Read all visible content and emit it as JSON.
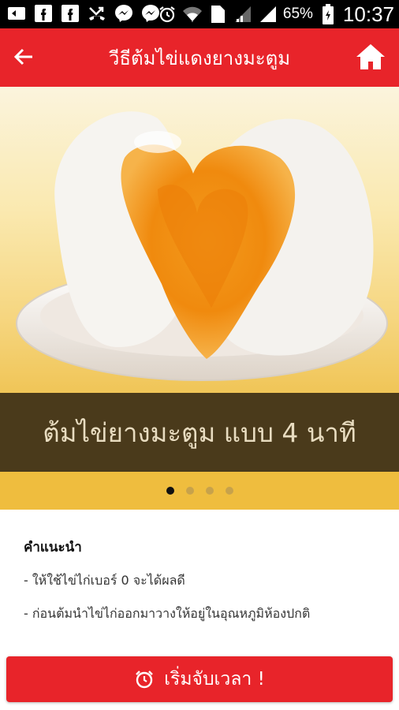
{
  "status_bar": {
    "icons": [
      "cast-icon",
      "facebook-icon",
      "facebook-icon",
      "missed-call-icon",
      "messenger-icon",
      "messenger-icon",
      "alarm-icon",
      "wifi-icon",
      "sim-1-icon",
      "signal-icon",
      "signal-icon",
      "battery-icon"
    ],
    "sim_label": "1",
    "battery": "65%",
    "time": "10:37"
  },
  "app_bar": {
    "title": "วีธีต้มไข่แดงยางมะตูม"
  },
  "hero": {
    "caption": "ต้มไข่ยางมะตูม แบบ 4 นาที",
    "slides_count": 4,
    "active_slide": 1
  },
  "advice": {
    "heading": "คำแนะนำ",
    "lines": [
      "- ให้ใช้ไข่ไก่เบอร์ 0 จะได้ผลดี",
      "- ก่อนต้มนำไข่ไก่ออกมาวางให้อยู่ในอุณหภูมิห้องปกติ"
    ]
  },
  "start_button": {
    "label": "เริ่มจับเวลา !",
    "icon": "alarm-clock-icon"
  },
  "colors": {
    "accent": "#e8242a",
    "caption_band": "#4a3a1b",
    "dots_band": "#efbd3e"
  }
}
